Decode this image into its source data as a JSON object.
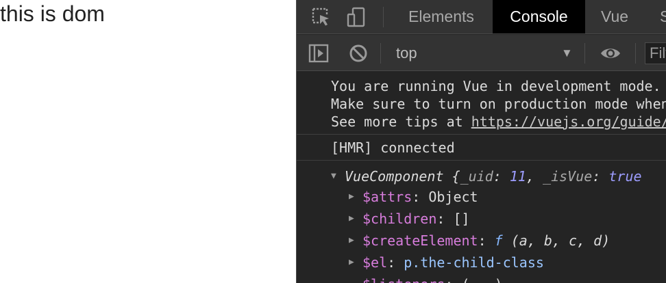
{
  "page": {
    "text": "this is dom"
  },
  "devtools": {
    "tabs": [
      {
        "label": "Elements",
        "active": false
      },
      {
        "label": "Console",
        "active": true
      },
      {
        "label": "Vue",
        "active": false
      },
      {
        "label": "S",
        "active": false
      }
    ],
    "toolbar": {
      "context": "top",
      "filter_placeholder": "Filter"
    },
    "console": {
      "vue_warning": [
        "You are running Vue in development mode.",
        "Make sure to turn on production mode when deploying for production.",
        "See more tips at "
      ],
      "vue_link": "https://vuejs.org/guide/deployment.html",
      "hmr": "[HMR] connected",
      "object": {
        "name": "VueComponent",
        "open_brace": " {",
        "uid_key": "_uid",
        "uid_value": "11",
        "isvue_key": "_isVue",
        "isvue_value": "true",
        "props": [
          {
            "key": "$attrs",
            "value": "Object"
          },
          {
            "key": "$children",
            "value": "[]"
          },
          {
            "key": "$createElement",
            "fn_mark": "f",
            "value": "(a, b, c, d)"
          },
          {
            "key": "$el",
            "value": "p.the-child-class"
          },
          {
            "key": "$listeners",
            "value": "(...)"
          }
        ]
      }
    },
    "colors": {
      "panel_bg": "#242424",
      "toolbar_bg": "#333333",
      "active_tab_bg": "#000000",
      "key_color": "#d77ddc",
      "value_color": "#9d9dff"
    }
  }
}
